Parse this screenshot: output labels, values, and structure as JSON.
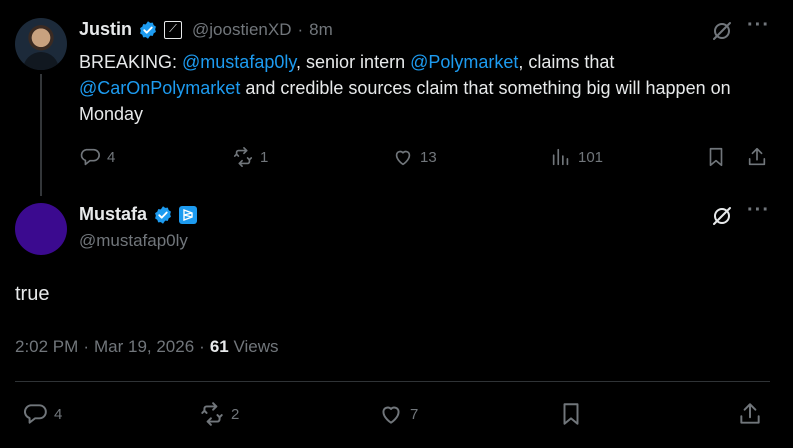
{
  "parent": {
    "name": "Justin",
    "handle": "@joostienXD",
    "sep": "·",
    "time": "8m",
    "text_parts": [
      {
        "t": "BREAKING: ",
        "m": false
      },
      {
        "t": "@mustafap0ly",
        "m": true
      },
      {
        "t": ", senior intern ",
        "m": false
      },
      {
        "t": "@Polymarket",
        "m": true
      },
      {
        "t": ", claims that ",
        "m": false
      },
      {
        "t": "@CarOnPolymarket",
        "m": true
      },
      {
        "t": " and credible sources claim that something big will happen on Monday",
        "m": false
      }
    ],
    "replies": "4",
    "reposts": "1",
    "likes": "13",
    "views": "101"
  },
  "main": {
    "name": "Mustafa",
    "handle": "@mustafap0ly",
    "text": "true",
    "time": "2:02 PM",
    "dot1": "·",
    "date": "Mar 19, 2026",
    "dot2": "·",
    "views_count": "61",
    "views_label": " Views",
    "replies": "4",
    "reposts": "2",
    "likes": "7"
  },
  "colors": {
    "accent": "#1d9bf0",
    "muted": "#71767b",
    "text": "#e7e9ea",
    "bg": "#000000",
    "avatar2": "#3b0a8f"
  }
}
